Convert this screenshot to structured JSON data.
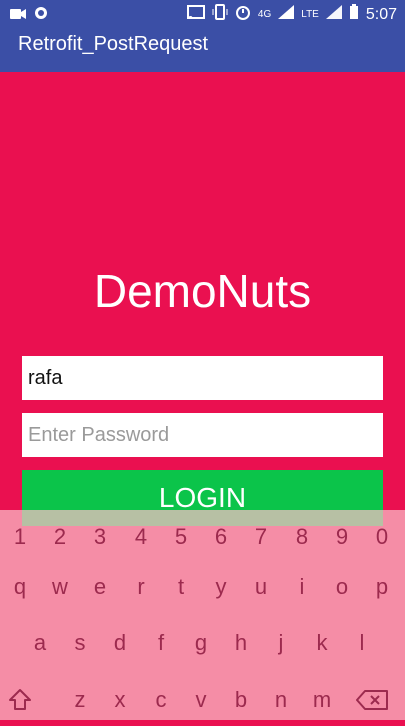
{
  "status_bar": {
    "time": "5:07",
    "network": "4G",
    "lte": "LTE",
    "left_icons": [
      "video-icon",
      "record-icon"
    ],
    "right_icons": [
      "cast-icon",
      "vibrate-icon",
      "alarm-icon",
      "signal-icon",
      "wifi-icon",
      "battery-icon"
    ]
  },
  "app": {
    "title": "Retrofit_PostRequest"
  },
  "brand": {
    "text": "DemoNuts"
  },
  "form": {
    "username_value": "rafa",
    "password_placeholder": "Enter Password",
    "login_label": "LOGIN"
  },
  "keyboard": {
    "number_row": [
      "1",
      "2",
      "3",
      "4",
      "5",
      "6",
      "7",
      "8",
      "9",
      "0"
    ],
    "row1": [
      "q",
      "w",
      "e",
      "r",
      "t",
      "y",
      "u",
      "i",
      "o",
      "p"
    ],
    "row2": [
      "a",
      "s",
      "d",
      "f",
      "g",
      "h",
      "j",
      "k",
      "l"
    ],
    "row3": [
      "z",
      "x",
      "c",
      "v",
      "b",
      "n",
      "m"
    ],
    "icons": [
      "shift-icon",
      "backspace-icon"
    ]
  },
  "colors": {
    "app_bar": "#3b4fa6",
    "background": "#ea1050",
    "login_button": "#0bc44a",
    "key_text": "#9c2a4e"
  }
}
